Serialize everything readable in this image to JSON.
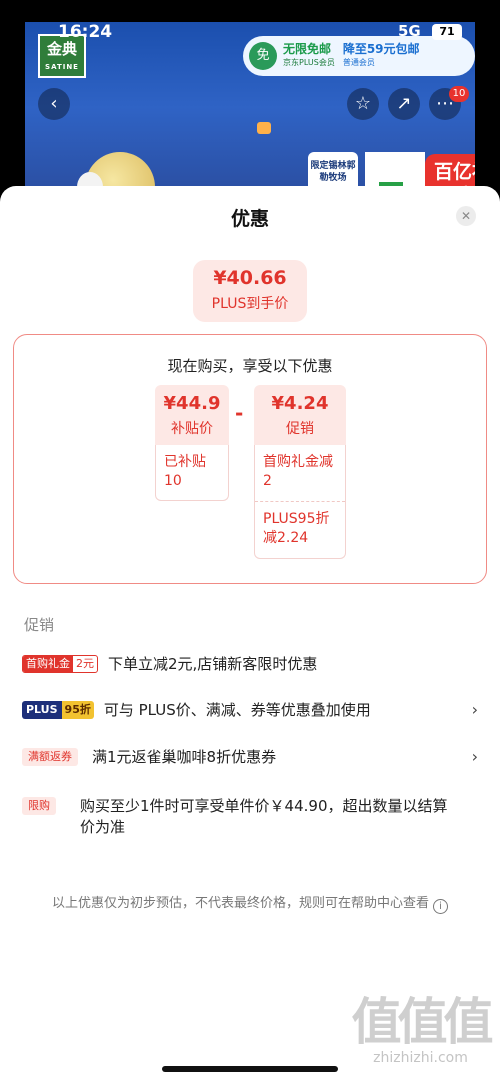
{
  "status_bar": {
    "time": "16:24",
    "network": "5G",
    "battery": "71"
  },
  "banner": {
    "brand_logo": "金典",
    "brand_logo_sub": "SATINE",
    "promo_badge": "免",
    "promo_main": "无限免邮",
    "promo_main_sub": "京东PLUS会员",
    "promo_side": "降至59元包邮",
    "promo_side_sub": "普通会员",
    "limited_tag": "限定锡林郭勒牧场",
    "subsidy_text": "百亿补贴",
    "more_badge": "10"
  },
  "sheet": {
    "title": "优惠",
    "close_icon": "close-icon",
    "final_price": {
      "amount": "¥40.66",
      "label": "PLUS到手价"
    },
    "detail": {
      "heading": "现在购买，享受以下优惠",
      "subsidy_price": {
        "amount": "¥44.9",
        "label": "补贴价"
      },
      "subsidy_note": "已补贴 10",
      "operator": "-",
      "discount": {
        "amount": "¥4.24",
        "label": "促销"
      },
      "discount_items": [
        "首购礼金减2",
        "PLUS95折减2.24"
      ]
    },
    "section_label": "促销",
    "promotions": [
      {
        "tag_a": "首购礼金",
        "tag_b": "2元",
        "text": "下单立减2元,店铺新客限时优惠"
      },
      {
        "tag_a": "PLUS",
        "tag_b": "95折",
        "text": "可与 PLUS价、满减、券等优惠叠加使用"
      },
      {
        "tag": "满额返券",
        "text": "满1元返雀巢咖啡8折优惠券"
      },
      {
        "tag": "限购",
        "text": "购买至少1件时可享受单件价￥44.90，超出数量以结算价为准"
      }
    ],
    "footnote": "以上优惠仅为初步预估，不代表最终价格，规则可在帮助中心查看",
    "info_icon": "i"
  },
  "watermark": {
    "big": "值值值",
    "small": "zhizhizhi.com"
  }
}
